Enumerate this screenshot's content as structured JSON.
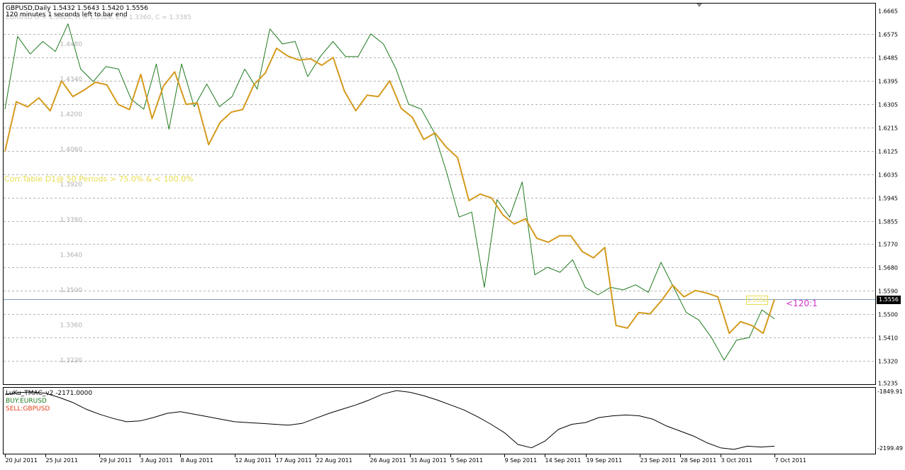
{
  "main_chart": {
    "title": "GBPUSD,Daily  1.5432 1.5643 1.5420 1.5556",
    "timer_text": "120 minutes 1 seconds left to bar end",
    "overlay_info": "EURUSD O = 1.3428, H = 1.3524, L = 1.3360, C = 1.3385",
    "corr_text": "Corr.Table D1@ 50 Periods > 75.0% & < 100.0%",
    "ratio_label": "<120:1",
    "price_box": "1.5556",
    "current_price": 1.5556,
    "colors": {
      "gbpusd": "#d49a1c",
      "eurusd": "#1f7a1f",
      "ratio": "#cc33cc",
      "corr": "#e0d84a",
      "price_line": "#7f9fbf"
    }
  },
  "sub_chart": {
    "title": "LuKu_TMAC_v2 -2171.0000",
    "buy_label": "BUY:EURUSD",
    "sell_label": "SELL:GBPUSD",
    "y_top_label": "-1849.91",
    "y_bottom_label": "-2199.49",
    "colors": {
      "buy": "#1f7a1f",
      "sell": "#e0401a"
    }
  },
  "chart_data": [
    {
      "type": "line",
      "x": [
        "20 Jul 2011",
        "21 Jul 2011",
        "22 Jul 2011",
        "25 Jul 2011",
        "26 Jul 2011",
        "27 Jul 2011",
        "28 Jul 2011",
        "29 Jul 2011",
        "1 Aug 2011",
        "2 Aug 2011",
        "3 Aug 2011",
        "4 Aug 2011",
        "5 Aug 2011",
        "8 Aug 2011",
        "9 Aug 2011",
        "10 Aug 2011",
        "11 Aug 2011",
        "12 Aug 2011",
        "15 Aug 2011",
        "16 Aug 2011",
        "17 Aug 2011",
        "18 Aug 2011",
        "19 Aug 2011",
        "22 Aug 2011",
        "23 Aug 2011",
        "24 Aug 2011",
        "25 Aug 2011",
        "26 Aug 2011",
        "29 Aug 2011",
        "30 Aug 2011",
        "31 Aug 2011",
        "1 Sep 2011",
        "2 Sep 2011",
        "5 Sep 2011",
        "6 Sep 2011",
        "7 Sep 2011",
        "8 Sep 2011",
        "9 Sep 2011",
        "12 Sep 2011",
        "13 Sep 2011",
        "14 Sep 2011",
        "15 Sep 2011",
        "16 Sep 2011",
        "19 Sep 2011",
        "20 Sep 2011",
        "21 Sep 2011",
        "22 Sep 2011",
        "23 Sep 2011",
        "26 Sep 2011",
        "27 Sep 2011",
        "28 Sep 2011",
        "29 Sep 2011",
        "30 Sep 2011",
        "3 Oct 2011",
        "4 Oct 2011",
        "5 Oct 2011",
        "6 Oct 2011",
        "7 Oct 2011"
      ],
      "x_tick_labels": [
        "20 Jul 2011",
        "25 Jul 2011",
        "29 Jul 2011",
        "3 Aug 2011",
        "8 Aug 2011",
        "12 Aug 2011",
        "17 Aug 2011",
        "22 Aug 2011",
        "26 Aug 2011",
        "31 Aug 2011",
        "5 Sep 2011",
        "9 Sep 2011",
        "14 Sep 2011",
        "19 Sep 2011",
        "23 Sep 2011",
        "28 Sep 2011",
        "3 Oct 2011",
        "7 Oct 2011"
      ],
      "y_right_ticks": [
        1.6665,
        1.6575,
        1.6485,
        1.6395,
        1.6305,
        1.6215,
        1.6125,
        1.6035,
        1.5945,
        1.5855,
        1.577,
        1.568,
        1.559,
        1.55,
        1.541,
        1.532,
        1.5235
      ],
      "y_left_ticks": [
        1.448,
        1.434,
        1.42,
        1.406,
        1.392,
        1.378,
        1.364,
        1.35,
        1.336,
        1.322
      ],
      "ylim_right": [
        1.5235,
        1.6665
      ],
      "grid": true,
      "series": [
        {
          "name": "GBPUSD",
          "axis": "right",
          "values": [
            1.6125,
            1.6315,
            1.6295,
            1.633,
            1.628,
            1.6395,
            1.6335,
            1.636,
            1.639,
            1.638,
            1.6305,
            1.6285,
            1.642,
            1.625,
            1.6375,
            1.643,
            1.6305,
            1.631,
            1.615,
            1.6235,
            1.6275,
            1.6285,
            1.638,
            1.6425,
            1.652,
            1.649,
            1.6475,
            1.648,
            1.6455,
            1.6485,
            1.6355,
            1.628,
            1.634,
            1.6335,
            1.6395,
            1.629,
            1.6255,
            1.617,
            1.6195,
            1.614,
            1.61,
            1.5935,
            1.596,
            1.5945,
            1.588,
            1.5845,
            1.5865,
            1.579,
            1.5775,
            1.58,
            1.58,
            1.574,
            1.5715,
            1.5755,
            1.5455,
            1.5445,
            1.5505,
            1.55,
            1.555,
            1.561,
            1.5565,
            1.559,
            1.558,
            1.5565,
            1.5425,
            1.547,
            1.5455,
            1.5425,
            1.5556
          ]
        },
        {
          "name": "EURUSD",
          "axis": "left",
          "values": [
            1.422,
            1.451,
            1.444,
            1.449,
            1.445,
            1.456,
            1.438,
            1.433,
            1.439,
            1.438,
            1.426,
            1.422,
            1.44,
            1.414,
            1.44,
            1.423,
            1.432,
            1.423,
            1.427,
            1.438,
            1.43,
            1.454,
            1.448,
            1.449,
            1.435,
            1.443,
            1.449,
            1.443,
            1.443,
            1.452,
            1.448,
            1.438,
            1.424,
            1.422,
            1.413,
            1.397,
            1.379,
            1.381,
            1.351,
            1.386,
            1.379,
            1.393,
            1.356,
            1.359,
            1.357,
            1.362,
            1.351,
            1.348,
            1.351,
            1.35,
            1.352,
            1.349,
            1.361,
            1.351,
            1.341,
            1.338,
            1.331,
            1.322,
            1.33,
            1.331,
            1.342,
            1.3385
          ]
        }
      ]
    },
    {
      "type": "line",
      "title": "LuKu_TMAC_v2 -2171.0000",
      "ylim": [
        -2199.49,
        -1849.91
      ],
      "series": [
        {
          "name": "LuKu_TMAC_v2",
          "values": [
            -1872,
            -1862,
            -1858,
            -1866,
            -1890,
            -1920,
            -1960,
            -1990,
            -2015,
            -2035,
            -2030,
            -2010,
            -1985,
            -1975,
            -1990,
            -2005,
            -2020,
            -2035,
            -2040,
            -2045,
            -2050,
            -2055,
            -2045,
            -2015,
            -1985,
            -1960,
            -1935,
            -1905,
            -1870,
            -1850,
            -1860,
            -1880,
            -1905,
            -1935,
            -1965,
            -2005,
            -2050,
            -2100,
            -2170,
            -2190,
            -2150,
            -2080,
            -2050,
            -2040,
            -2010,
            -2000,
            -1995,
            -2000,
            -2020,
            -2060,
            -2090,
            -2120,
            -2160,
            -2190,
            -2199,
            -2180,
            -2185,
            -2180
          ]
        }
      ]
    }
  ]
}
